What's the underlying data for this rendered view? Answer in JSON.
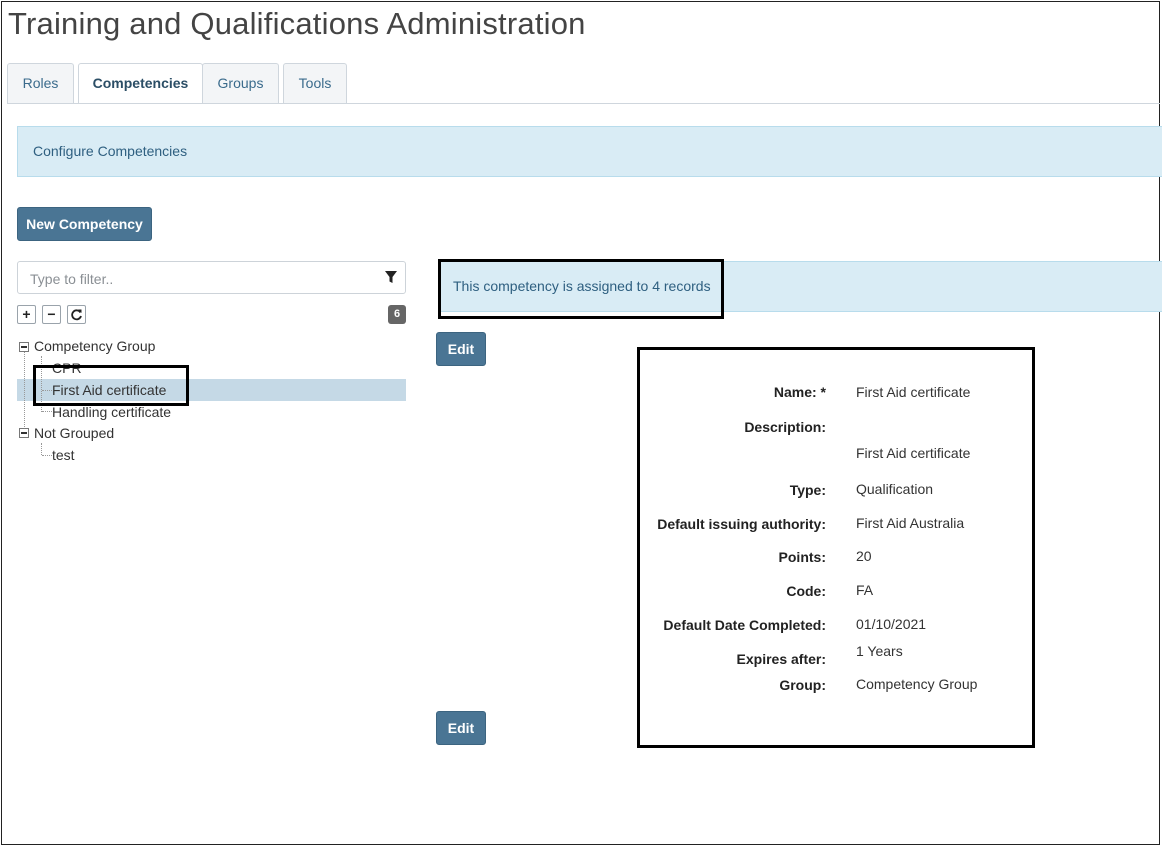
{
  "page_title": "Training and Qualifications Administration",
  "tabs": [
    {
      "label": "Roles"
    },
    {
      "label": "Competencies"
    },
    {
      "label": "Groups"
    },
    {
      "label": "Tools"
    }
  ],
  "active_tab": "Competencies",
  "info_bar": "Configure Competencies",
  "new_button": "New Competency",
  "filter": {
    "placeholder": "Type to filter..",
    "value": ""
  },
  "tree_controls": {
    "expand": "+",
    "collapse": "−",
    "count": "6"
  },
  "tree": [
    {
      "label": "Competency Group",
      "type": "group",
      "children": [
        {
          "label": "CPR"
        },
        {
          "label": "First Aid certificate",
          "selected": true
        },
        {
          "label": "Handling certificate"
        }
      ]
    },
    {
      "label": "Not Grouped",
      "type": "group",
      "children": [
        {
          "label": "test"
        }
      ]
    }
  ],
  "assigned_message": "This competency is assigned to 4 records",
  "edit_button": "Edit",
  "details": {
    "name_label": "Name: *",
    "name": "First Aid certificate",
    "description_label": "Description:",
    "description": "First Aid certificate",
    "type_label": "Type:",
    "type": "Qualification",
    "authority_label": "Default issuing authority:",
    "authority": "First Aid Australia",
    "points_label": "Points:",
    "points": "20",
    "code_label": "Code:",
    "code": "FA",
    "date_label": "Default Date Completed:",
    "date": "01/10/2021",
    "expires_label": "Expires after:",
    "expires": "1 Years",
    "group_label": "Group:",
    "group": "Competency Group"
  },
  "colors": {
    "primary_button": "#4a7594",
    "info_background": "#d9ecf5",
    "selected_row": "#c5d9e6"
  }
}
